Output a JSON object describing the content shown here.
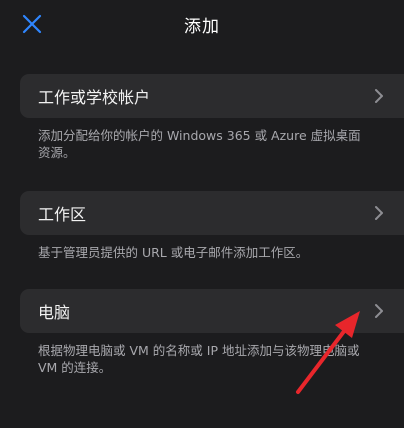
{
  "header": {
    "title": "添加",
    "close_icon": "close-x-icon"
  },
  "options": [
    {
      "label": "工作或学校帐户",
      "description": "添加分配给你的帐户的 Windows 365 或 Azure 虚拟桌面资源。"
    },
    {
      "label": "工作区",
      "description": "基于管理员提供的 URL 或电子邮件添加工作区。"
    },
    {
      "label": "电脑",
      "description": "根据物理电脑或 VM 的名称或 IP 地址添加与该物理电脑或 VM 的连接。"
    }
  ],
  "colors": {
    "background": "#1c1c1e",
    "card": "#2c2c2e",
    "accent_blue": "#2f86ff",
    "annotation_red": "#e8262b"
  }
}
